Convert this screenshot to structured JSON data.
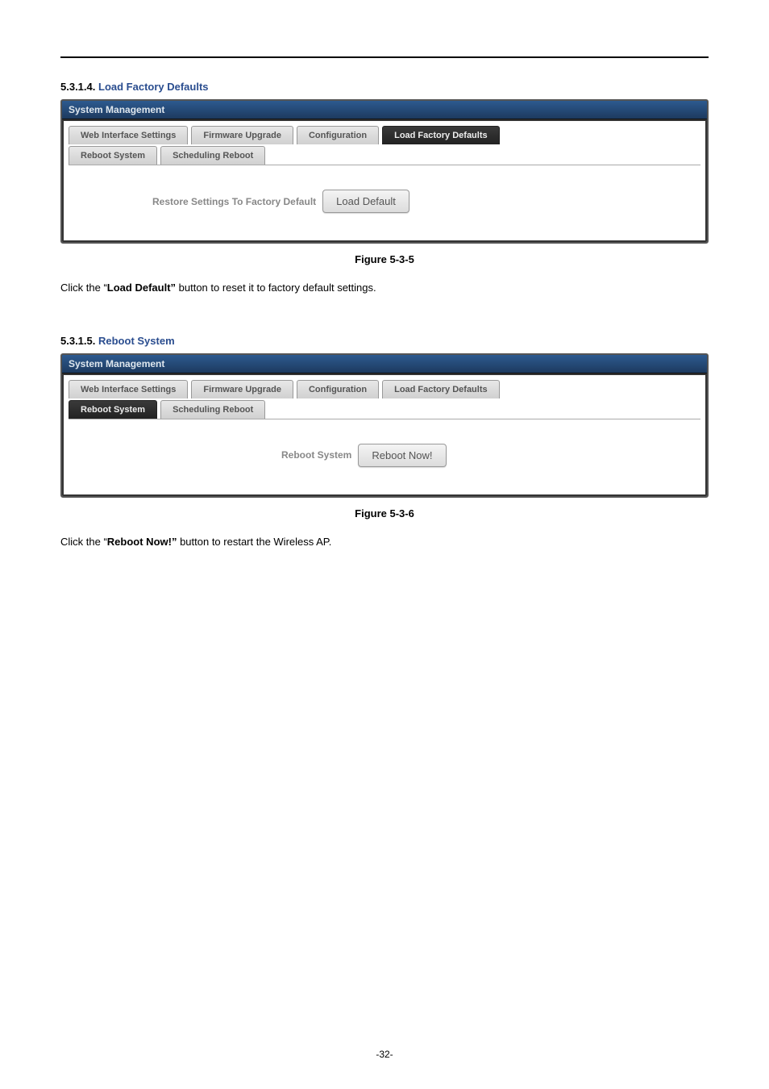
{
  "section1": {
    "number": "5.3.1.4.",
    "title": "Load Factory Defaults",
    "panel_title": "System Management",
    "tabs_row1": {
      "web_interface": "Web Interface Settings",
      "firmware": "Firmware Upgrade",
      "configuration": "Configuration",
      "load_defaults": "Load Factory Defaults"
    },
    "tabs_row2": {
      "reboot_system": "Reboot System",
      "scheduling_reboot": "Scheduling Reboot"
    },
    "content_label": "Restore Settings To Factory Default",
    "button_label": "Load Default",
    "caption": "Figure 5-3-5",
    "body_prefix": "Click the “",
    "body_bold": "Load Default”",
    "body_suffix": " button to reset it to factory default settings."
  },
  "section2": {
    "number": "5.3.1.5.",
    "title": "Reboot System",
    "panel_title": "System Management",
    "tabs_row1": {
      "web_interface": "Web Interface Settings",
      "firmware": "Firmware Upgrade",
      "configuration": "Configuration",
      "load_defaults": "Load Factory Defaults"
    },
    "tabs_row2": {
      "reboot_system": "Reboot System",
      "scheduling_reboot": "Scheduling Reboot"
    },
    "content_label": "Reboot System",
    "button_label": "Reboot Now!",
    "caption": "Figure 5-3-6",
    "body_prefix": "Click the “",
    "body_bold": "Reboot Now!”",
    "body_suffix": " button to restart the Wireless AP."
  },
  "footer": "-32-"
}
